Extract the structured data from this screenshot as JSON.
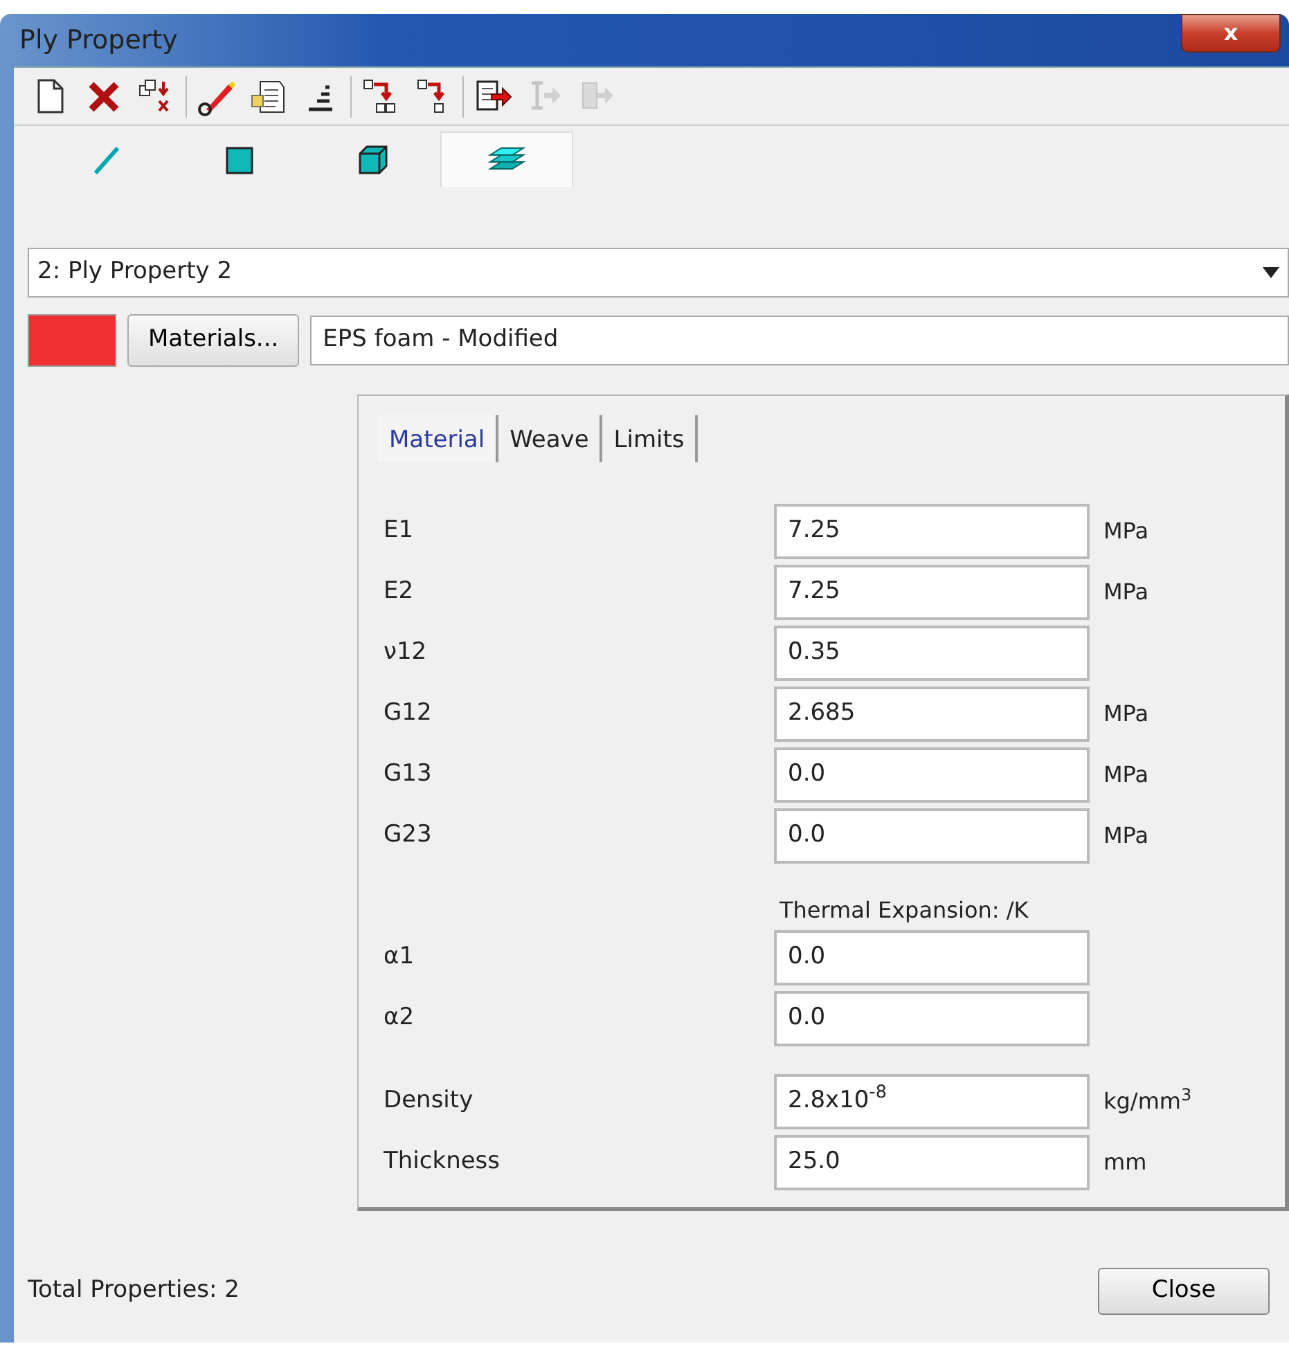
{
  "window": {
    "title": "Ply Property",
    "close_label": "x"
  },
  "toolbar": [
    [
      {
        "kind": "new",
        "disabled": false
      },
      {
        "kind": "delete",
        "disabled": false
      },
      {
        "kind": "copy-delete",
        "disabled": false
      }
    ],
    [
      {
        "kind": "edit",
        "disabled": false
      },
      {
        "kind": "properties",
        "disabled": false
      },
      {
        "kind": "sort",
        "disabled": false
      }
    ],
    [
      {
        "kind": "copy-down",
        "disabled": false
      },
      {
        "kind": "move-down",
        "disabled": false
      }
    ],
    [
      {
        "kind": "export",
        "disabled": false
      },
      {
        "kind": "export-single",
        "disabled": true
      },
      {
        "kind": "export-multi",
        "disabled": true
      }
    ]
  ],
  "shape_tabs": [
    {
      "kind": "line",
      "selected": false
    },
    {
      "kind": "square",
      "selected": false
    },
    {
      "kind": "cube",
      "selected": false
    },
    {
      "kind": "layers",
      "selected": true
    }
  ],
  "property_select": {
    "value": "2: Ply Property 2"
  },
  "color_swatch": {
    "color": "#f03030"
  },
  "materials_button": "Materials...",
  "material_name": "EPS foam - Modified",
  "tabs": [
    {
      "label": "Material",
      "selected": true
    },
    {
      "label": "Weave",
      "selected": false
    },
    {
      "label": "Limits",
      "selected": false
    }
  ],
  "stiffness": [
    {
      "label": "E1",
      "value": "7.25",
      "unit": "MPa"
    },
    {
      "label": "E2",
      "value": "7.25",
      "unit": "MPa"
    },
    {
      "label": "ν12",
      "value": "0.35"
    },
    {
      "label": "G12",
      "value": "2.685",
      "unit": "MPa"
    },
    {
      "label": "G13",
      "value": "0.0",
      "unit": "MPa"
    },
    {
      "label": "G23",
      "value": "0.0",
      "unit": "MPa"
    }
  ],
  "thermal": {
    "heading": "Thermal Expansion: /K",
    "rows": [
      {
        "label": "α1",
        "value": "0.0"
      },
      {
        "label": "α2",
        "value": "0.0"
      }
    ]
  },
  "physical": [
    {
      "label": "Density",
      "value": "2.8x10$^{-8}$",
      "unit": "kg/mm$^{3}$"
    },
    {
      "label": "Thickness",
      "value": "25.0",
      "unit": "mm"
    }
  ],
  "status": "Total Properties: 2",
  "close_button": "Close"
}
